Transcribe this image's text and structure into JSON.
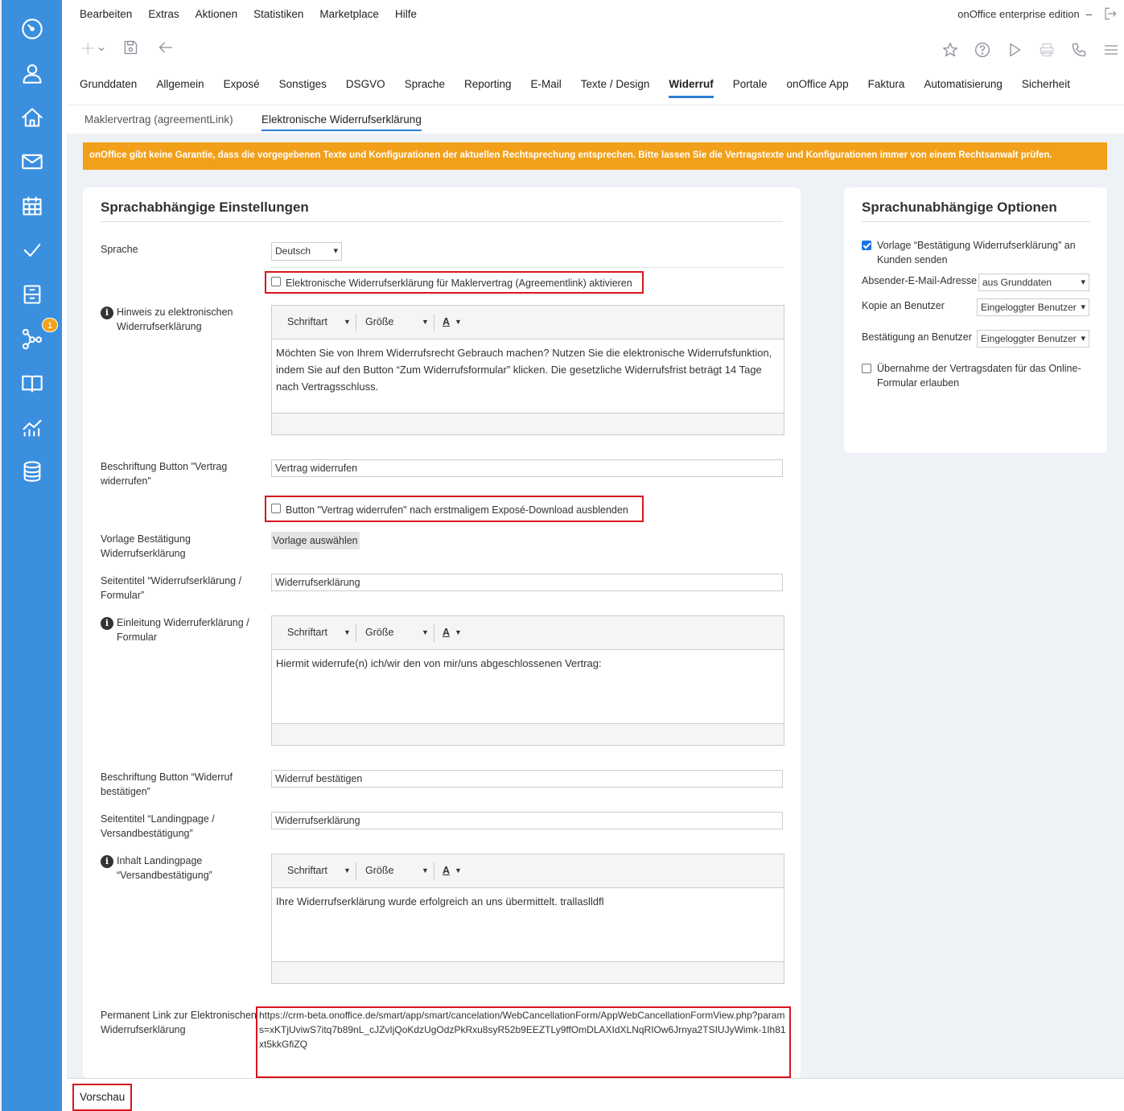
{
  "top_menu": [
    "Bearbeiten",
    "Extras",
    "Aktionen",
    "Statistiken",
    "Marketplace",
    "Hilfe"
  ],
  "edition": {
    "label": "onOffice enterprise edition",
    "dash": "–"
  },
  "main_tabs": [
    "Grunddaten",
    "Allgemein",
    "Exposé",
    "Sonstiges",
    "DSGVO",
    "Sprache",
    "Reporting",
    "E-Mail",
    "Texte / Design",
    "Widerruf",
    "Portale",
    "onOffice App",
    "Faktura",
    "Automatisierung",
    "Sicherheit"
  ],
  "active_main_tab": "Widerruf",
  "sub_tabs": [
    "Maklervertrag (agreementLink)",
    "Elektronische Widerrufserklärung"
  ],
  "badge_count": "1",
  "warning": "onOffice gibt keine Garantie, dass die vorgegebenen Texte und Konfigurationen der aktuellen Rechtsprechung entsprechen. Bitte lassen Sie die Vertragstexte und Konfigurationen immer von einem Rechtsanwalt prüfen.",
  "left_card": {
    "title": "Sprachabhängige Einstellungen",
    "sprache_label": "Sprache",
    "sprache_value": "Deutsch",
    "activate_checkbox": "Elektronische Widerrufserklärung für Maklervertrag (Agreementlink) aktivieren",
    "hinweis_label": "Hinweis zu elektronischen Widerrufserklärung",
    "editor_font": "Schriftart",
    "editor_size": "Größe",
    "editor_color": "A",
    "hinweis_text": "Möchten Sie von Ihrem Widerrufsrecht Gebrauch machen? Nutzen Sie die elektronische Widerrufsfunktion, indem Sie auf den Button “Zum Widerrufsformular” klicken. Die gesetzliche Widerrufsfrist beträgt 14 Tage nach Vertragsschluss.",
    "btn_vertrag_label": "Beschriftung Button \"Vertrag widerrufen\"",
    "btn_vertrag_value": "Vertrag widerrufen",
    "hide_checkbox": "Button \"Vertrag widerrufen\" nach erstmaligem Exposé-Download ausblenden",
    "vorlage_label": "Vorlage Bestätigung Widerrufserklärung",
    "vorlage_button": "Vorlage auswählen",
    "seitentitel_label": "Seitentitel “Widerrufserklärung / Formular”",
    "seitentitel_value": "Widerrufserklärung",
    "einleitung_label": "Einleitung Widerruferklärung / Formular",
    "einleitung_text": "Hiermit widerrufe(n) ich/wir den von mir/uns abgeschlossenen Vertrag:",
    "btn_bestaetigen_label": "Beschriftung Button “Widerruf bestätigen”",
    "btn_bestaetigen_value": "Widerruf bestätigen",
    "landing_title_label": "Seitentitel “Landingpage / Versandbestätigung”",
    "landing_title_value": "Widerrufserklärung",
    "landing_content_label": "Inhalt Landingpage “Versandbestätigung”",
    "landing_content_text": "Ihre Widerrufserklärung wurde erfolgreich an uns übermittelt. trallaslldfl",
    "permalink_label": "Permanent Link zur Elektronischen Widerrufserklärung",
    "permalink_value": "https://crm-beta.onoffice.de/smart/app/smart/cancelation/WebCancellationForm/AppWebCancellationFormView.php?params=xKTjUviwS7itq7b89nL_cJZvIjQoKdzUgOdzPkRxu8syR52b9EEZTLy9ffOmDLAXIdXLNqRIOw6Jrnya2TSIUJyWimk-1Ih81xt5kkGfiZQ"
  },
  "right_card": {
    "title": "Sprachunabhängige Optionen",
    "vorlage_checkbox": "Vorlage “Bestätigung Widerrufserklärung” an Kunden senden",
    "absender_label": "Absender-E-Mail-Adresse",
    "absender_value": "aus Grunddaten",
    "kopie_label": "Kopie an Benutzer",
    "kopie_value": "Eingeloggter Benutzer",
    "bestaetigung_label": "Bestätigung an Benutzer",
    "bestaetigung_value": "Eingeloggter Benutzer",
    "uebernahme_checkbox": "Übernahme der Vertragsdaten für das Online-Formular erlauben"
  },
  "footer": {
    "preview": "Vorschau"
  },
  "colors": {
    "sidebar": "#3b8fdf",
    "warning": "#f2a01a",
    "accent": "#2d7fd2",
    "highlight": "#d9161e"
  }
}
